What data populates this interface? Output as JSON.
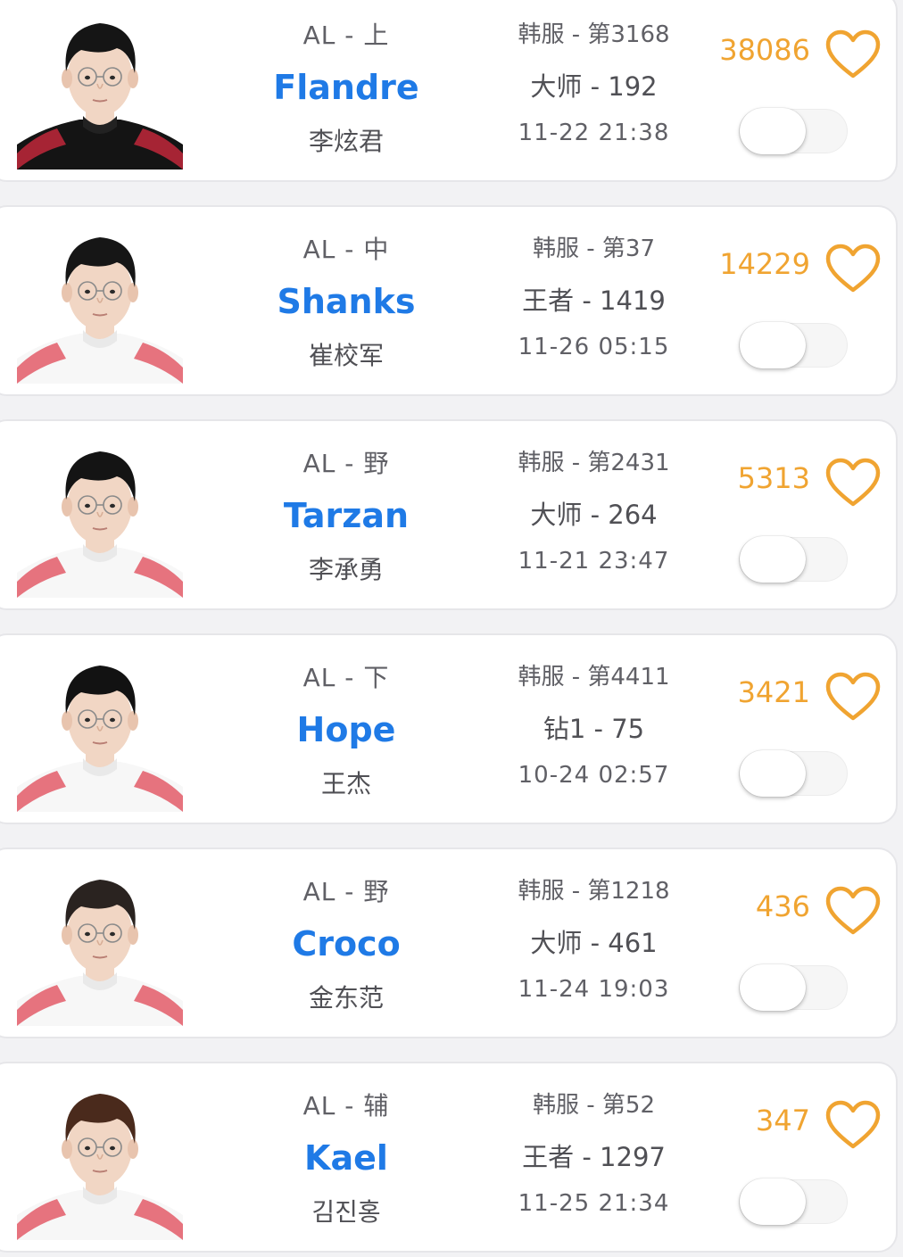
{
  "colors": {
    "player_id": "#1f7ae6",
    "likes": "#f0a431",
    "heart": "#f0a431",
    "card_bg": "#ffffff"
  },
  "players": [
    {
      "team_pos": "AL - 上",
      "player_id": "Flandre",
      "real_name": "李炫君",
      "server_rank": "韩服 - 第3168",
      "tier": "大师 - 192",
      "time": "11-22 21:38",
      "likes": "38086",
      "subscribed": false,
      "hair_color": "#151515",
      "jersey": "dark"
    },
    {
      "team_pos": "AL - 中",
      "player_id": "Shanks",
      "real_name": "崔校军",
      "server_rank": "韩服 - 第37",
      "tier": "王者 - 1419",
      "time": "11-26 05:15",
      "likes": "14229",
      "subscribed": false,
      "hair_color": "#161616",
      "jersey": "white"
    },
    {
      "team_pos": "AL - 野",
      "player_id": "Tarzan",
      "real_name": "李承勇",
      "server_rank": "韩服 - 第2431",
      "tier": "大师 - 264",
      "time": "11-21 23:47",
      "likes": "5313",
      "subscribed": false,
      "hair_color": "#141414",
      "jersey": "white"
    },
    {
      "team_pos": "AL - 下",
      "player_id": "Hope",
      "real_name": "王杰",
      "server_rank": "韩服 - 第4411",
      "tier": "钻1 - 75",
      "time": "10-24 02:57",
      "likes": "3421",
      "subscribed": false,
      "hair_color": "#121212",
      "jersey": "white"
    },
    {
      "team_pos": "AL - 野",
      "player_id": "Croco",
      "real_name": "金东范",
      "server_rank": "韩服 - 第1218",
      "tier": "大师 - 461",
      "time": "11-24 19:03",
      "likes": "436",
      "subscribed": false,
      "hair_color": "#2a2320",
      "jersey": "white"
    },
    {
      "team_pos": "AL - 辅",
      "player_id": "Kael",
      "real_name": "김진홍",
      "server_rank": "韩服 - 第52",
      "tier": "王者 - 1297",
      "time": "11-25 21:34",
      "likes": "347",
      "subscribed": false,
      "hair_color": "#4a2a1c",
      "jersey": "white"
    }
  ]
}
